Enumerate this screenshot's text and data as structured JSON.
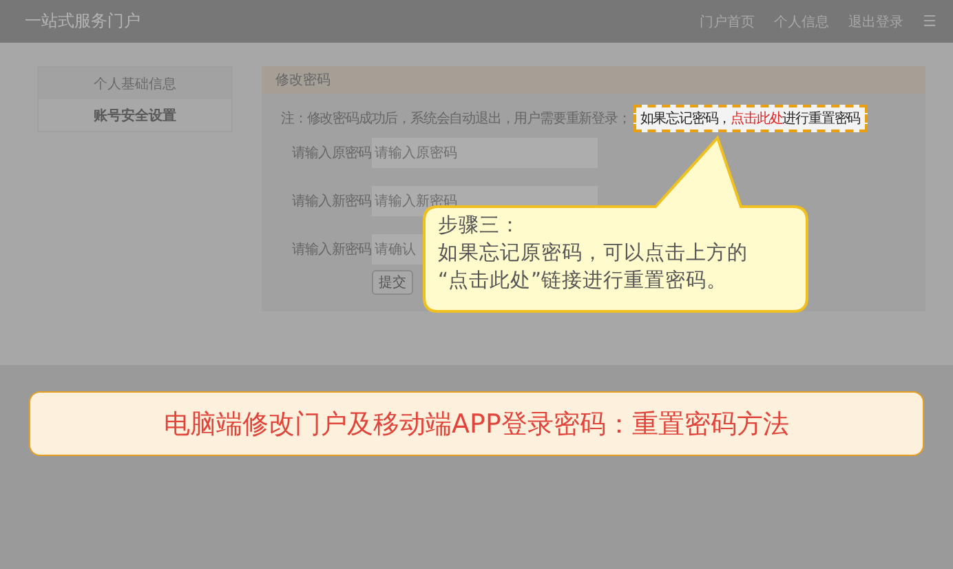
{
  "header": {
    "title": "一站式服务门户",
    "nav": [
      "门户首页",
      "个人信息",
      "退出登录"
    ],
    "menu_icon": "☰"
  },
  "sidebar": {
    "items": [
      {
        "label": "个人基础信息",
        "selected": false
      },
      {
        "label": "账号安全设置",
        "selected": true
      }
    ]
  },
  "panel": {
    "title": "修改密码",
    "note": "注：修改密码成功后，系统会自动退出，用户需要重新登录；",
    "forgot": {
      "before": "如果忘记密码，",
      "link": "点击此处",
      "after": "进行重置密码"
    },
    "fields": [
      {
        "label": "请输入原密码",
        "placeholder": "请输入原密码"
      },
      {
        "label": "请输入新密码",
        "placeholder": "请输入新密码"
      },
      {
        "label": "请输入新密码",
        "placeholder": "请确认"
      }
    ],
    "submit": "提交"
  },
  "callout": {
    "lines": [
      "步骤三：",
      "如果忘记原密码，可以点击上方的",
      "“点击此处”链接进行重置密码。"
    ]
  },
  "banner": "电脑端修改门户及移动端APP登录密码：重置密码方法"
}
